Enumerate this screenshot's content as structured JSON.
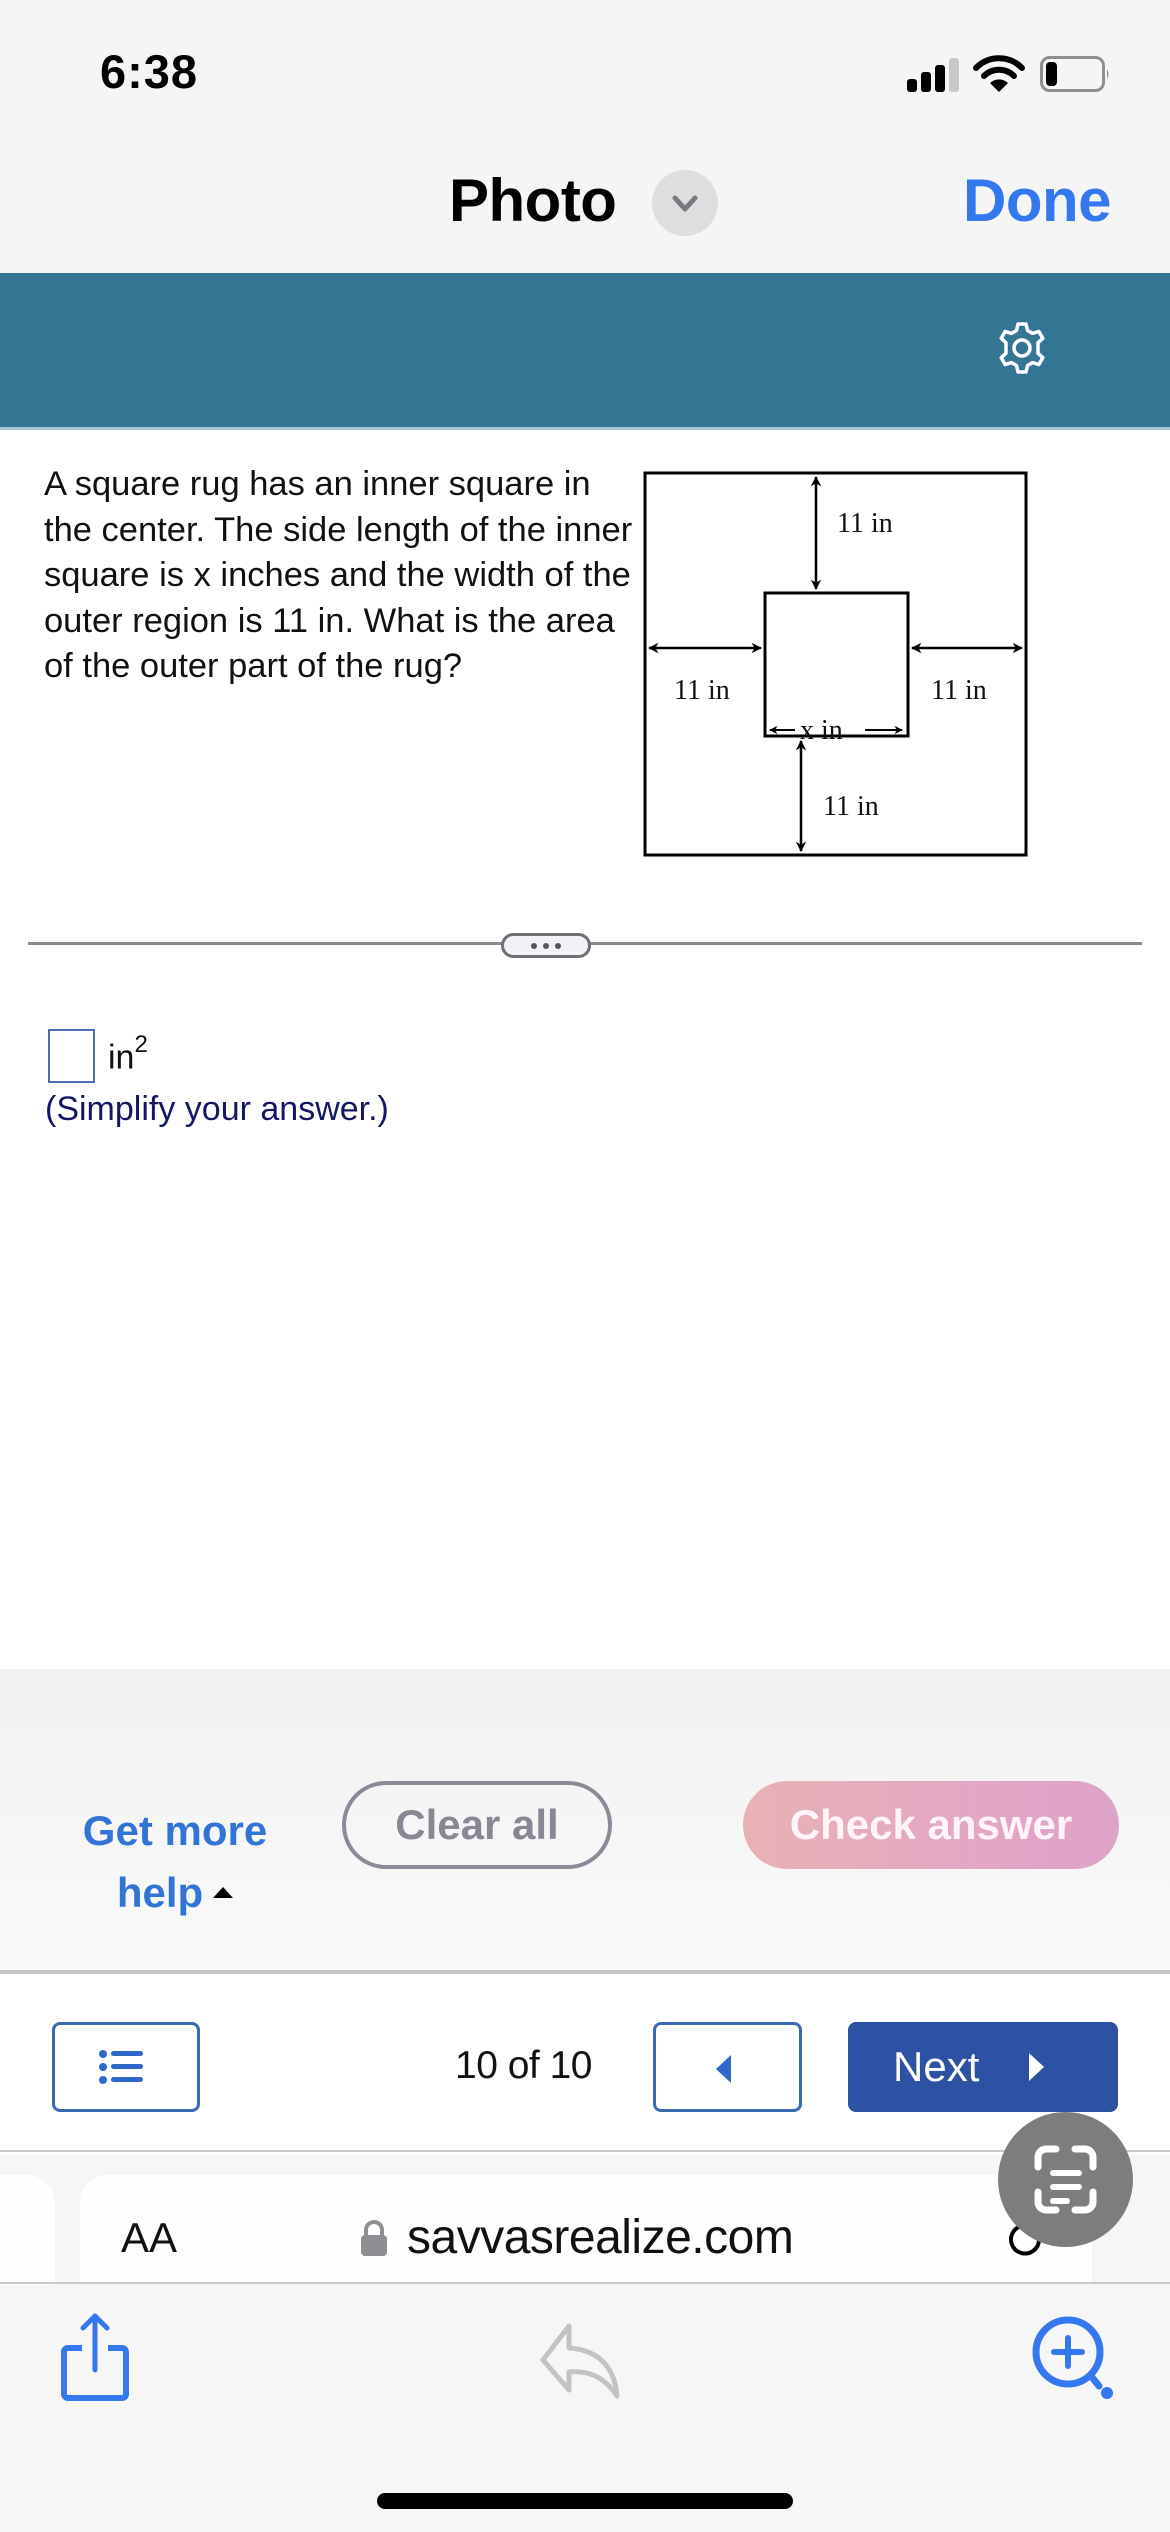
{
  "status_bar": {
    "time": "6:38",
    "icons": [
      "cellular-signal-icon",
      "wifi-icon",
      "battery-low-icon"
    ]
  },
  "nav": {
    "title": "Photo",
    "title_menu_icon": "chevron-down-icon",
    "done_label": "Done"
  },
  "app_bar": {
    "settings_icon": "gear-icon",
    "color": "#357594"
  },
  "question": {
    "text": "A square rug has an inner square in the center. The side length of the inner square is x inches and the width of the outer region is 11 in. What is the area of the outer part of the rug?",
    "diagram": {
      "top_label": "11 in",
      "left_label": "11 in",
      "right_label": "11 in",
      "bottom_label": "11 in",
      "inner_label": "x in"
    }
  },
  "divider": {
    "more_icon": "ellipsis-icon"
  },
  "answer": {
    "value": "",
    "unit": "in",
    "unit_exponent": "2",
    "hint": "(Simplify your answer.)"
  },
  "actions": {
    "get_more_help_line1": "Get more",
    "get_more_help_line2": "help",
    "clear_all": "Clear all",
    "check_answer": "Check answer",
    "accent_link_color": "#3274d6",
    "check_answer_color": "#e3a5c6"
  },
  "pager": {
    "list_icon": "question-list-icon",
    "page_text": "10 of 10",
    "current_page": 10,
    "total_pages": 10,
    "prev_icon": "triangle-left-icon",
    "next_label": "Next",
    "next_icon": "triangle-right-icon",
    "next_color": "#2d52a3"
  },
  "browser": {
    "text_size_label": "AA",
    "url": "savvasrealize.com",
    "lock_icon": "lock-icon",
    "reload_icon": "reload-icon",
    "live_text_icon": "live-text-scan-icon",
    "toolbar": [
      "share-icon",
      "reply-icon",
      "zoom-in-icon"
    ]
  }
}
